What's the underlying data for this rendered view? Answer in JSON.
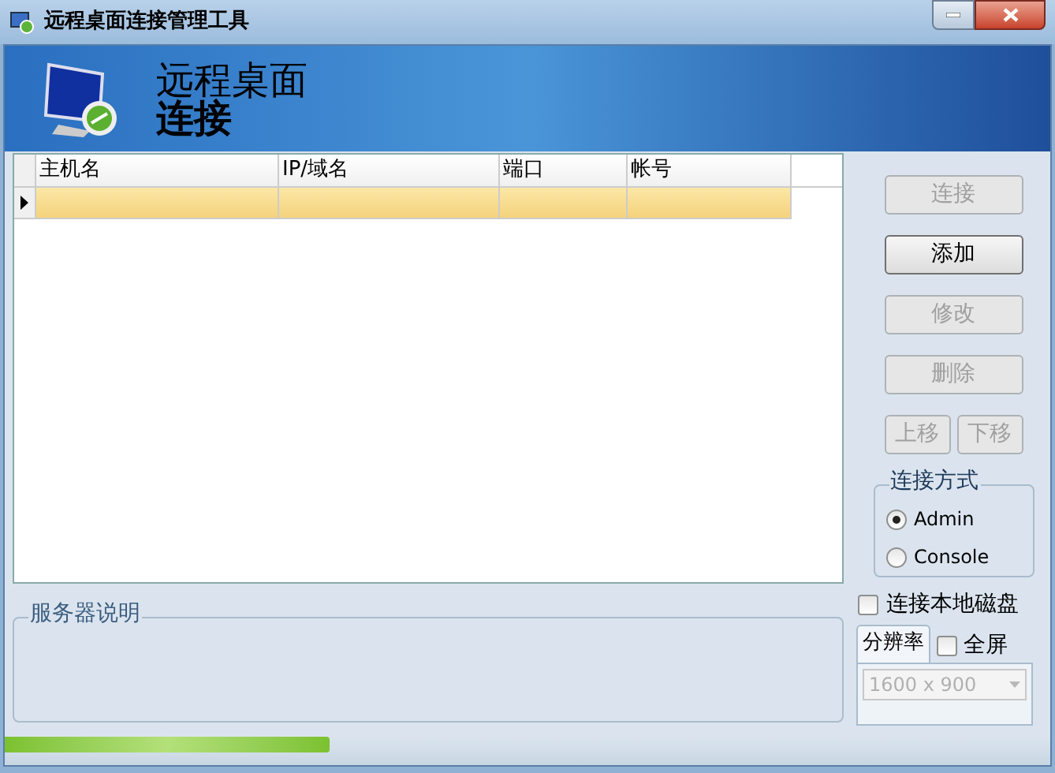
{
  "window": {
    "title": "远程桌面连接管理工具"
  },
  "banner": {
    "line_1": "远程桌面",
    "line_2": "连接"
  },
  "table": {
    "columns": [
      "主机名",
      "IP/域名",
      "端口",
      "帐号"
    ],
    "rows": [
      {
        "selected": true
      }
    ]
  },
  "buttons": [
    {
      "kind": "wide",
      "label": "连接",
      "disabled": true
    },
    {
      "kind": "wide",
      "label": "添加",
      "disabled": false
    },
    {
      "kind": "wide",
      "label": "修改",
      "disabled": true
    },
    {
      "kind": "wide",
      "label": "删除",
      "disabled": true
    },
    {
      "kind": "half",
      "label": "上移",
      "disabled": true
    },
    {
      "kind": "half",
      "label": "下移",
      "disabled": true
    }
  ],
  "connection_mode": {
    "label": "连接方式",
    "options": [
      {
        "label": "Admin",
        "selected": true
      },
      {
        "label": "Console",
        "selected": false
      }
    ]
  },
  "local_disk": {
    "label": "连接本地磁盘",
    "checked": false
  },
  "resolution_tab": {
    "label": "分辨率",
    "selected": true
  },
  "fullscreen": {
    "label": "全屏",
    "checked": false
  },
  "resolution": {
    "value": "1600 x 900",
    "disabled": true
  },
  "description": {
    "label": "服务器说明"
  },
  "progress": {
    "level": 0.31
  }
}
